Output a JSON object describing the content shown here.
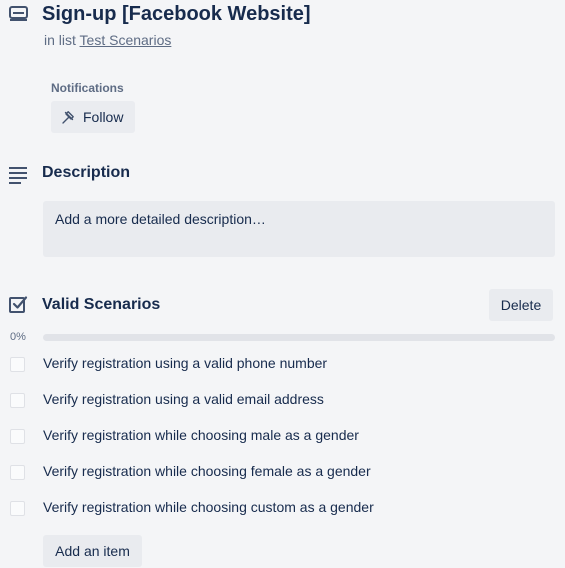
{
  "card": {
    "title": "Sign-up [Facebook Website]",
    "in_list_prefix": "in list",
    "list_name": "Test Scenarios"
  },
  "notifications": {
    "label": "Notifications",
    "follow_label": "Follow"
  },
  "description": {
    "title": "Description",
    "placeholder": "Add a more detailed description…"
  },
  "checklist": {
    "title": "Valid Scenarios",
    "delete_label": "Delete",
    "progress_text": "0%",
    "progress": 0,
    "items": [
      {
        "text": "Verify registration using a valid phone number",
        "checked": false
      },
      {
        "text": "Verify registration using a valid email address",
        "checked": false
      },
      {
        "text": "Verify registration while choosing male as a gender",
        "checked": false
      },
      {
        "text": "Verify registration while choosing female as a gender",
        "checked": false
      },
      {
        "text": "Verify registration while choosing custom as a gender",
        "checked": false
      }
    ],
    "add_item_label": "Add an item"
  },
  "colors": {
    "text": "#172b4d",
    "muted": "#5e6c84",
    "button_bg": "#e9ebef",
    "progress_complete": "#5aac44"
  }
}
